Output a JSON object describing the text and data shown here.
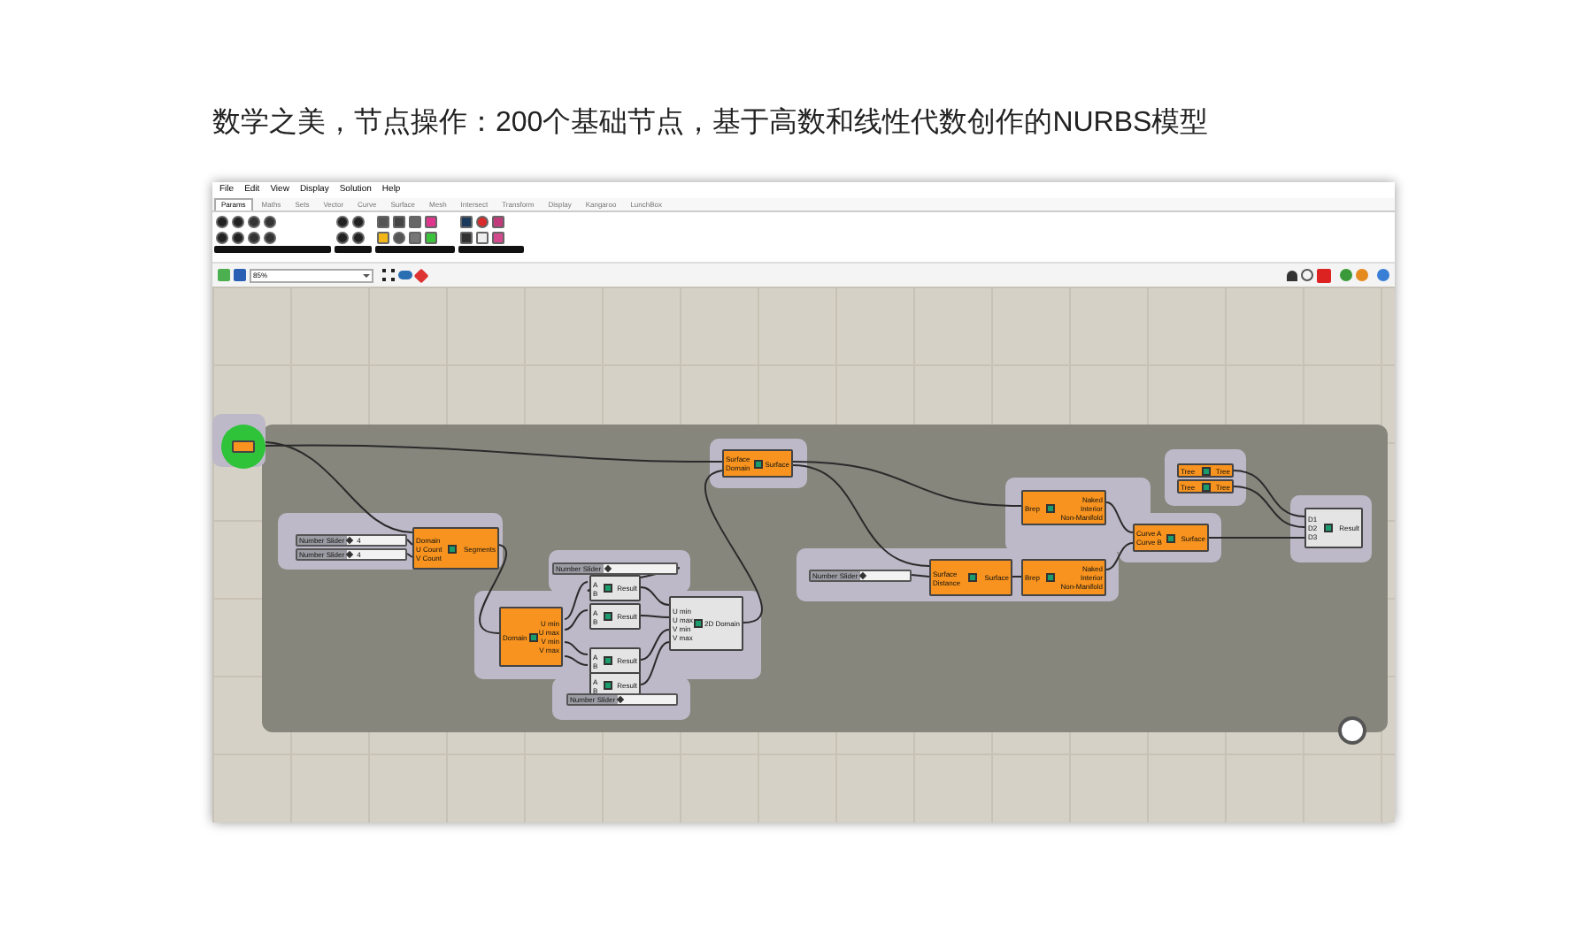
{
  "heading": "数学之美，节点操作：200个基础节点，基于高数和线性代数创作的NURBS模型",
  "menu": [
    "File",
    "Edit",
    "View",
    "Display",
    "Solution",
    "Help"
  ],
  "tabs": [
    {
      "label": "Params",
      "selected": true
    },
    {
      "label": "Maths",
      "selected": false
    },
    {
      "label": "Sets",
      "selected": false
    },
    {
      "label": "Vector",
      "selected": false
    },
    {
      "label": "Curve",
      "selected": false
    },
    {
      "label": "Surface",
      "selected": false
    },
    {
      "label": "Mesh",
      "selected": false
    },
    {
      "label": "Intersect",
      "selected": false
    },
    {
      "label": "Transform",
      "selected": false
    },
    {
      "label": "Display",
      "selected": false
    },
    {
      "label": "Kangaroo",
      "selected": false
    },
    {
      "label": "LunchBox",
      "selected": false
    }
  ],
  "canvas_toolbar": {
    "zoom": "85%"
  },
  "nodes": [
    {
      "kind": "cluster",
      "selected": true
    },
    {
      "kind": "slider",
      "label": "Number Slider",
      "value": "4",
      "level": 0.05
    },
    {
      "kind": "slider",
      "label": "Number Slider",
      "value": "4",
      "level": 0.05
    },
    {
      "kind": "component",
      "selected": true,
      "inputs": [
        "Domain",
        "U Count",
        "V Count"
      ],
      "outputs": [
        "Segments"
      ]
    },
    {
      "kind": "component",
      "selected": true,
      "inputs": [
        "Domain"
      ],
      "outputs": [
        "U min",
        "U max",
        "V min",
        "V max"
      ]
    },
    {
      "kind": "slider",
      "label": "Number Slider",
      "level": 0.05
    },
    {
      "kind": "component",
      "selected": false,
      "inputs": [
        "A",
        "B"
      ],
      "outputs": [
        "Result"
      ]
    },
    {
      "kind": "component",
      "selected": false,
      "inputs": [
        "A",
        "B"
      ],
      "outputs": [
        "Result"
      ]
    },
    {
      "kind": "component",
      "selected": false,
      "inputs": [
        "A",
        "B"
      ],
      "outputs": [
        "Result"
      ]
    },
    {
      "kind": "component",
      "selected": false,
      "inputs": [
        "A",
        "B"
      ],
      "outputs": [
        "Result"
      ]
    },
    {
      "kind": "component",
      "selected": false,
      "inputs": [
        "U min",
        "U max",
        "V min",
        "V max"
      ],
      "outputs": [
        "2D Domain"
      ]
    },
    {
      "kind": "slider",
      "label": "Number Slider",
      "level": 0.05
    },
    {
      "kind": "component",
      "selected": true,
      "inputs": [
        "Surface",
        "Domain"
      ],
      "outputs": [
        "Surface"
      ]
    },
    {
      "kind": "slider",
      "label": "Number Slider",
      "level": 0.05
    },
    {
      "kind": "component",
      "selected": true,
      "inputs": [
        "Surface",
        "Distance"
      ],
      "outputs": [
        "Surface"
      ]
    },
    {
      "kind": "component",
      "selected": true,
      "inputs": [
        "Brep"
      ],
      "outputs": [
        "Naked",
        "Interior",
        "Non-Manifold"
      ]
    },
    {
      "kind": "component",
      "selected": true,
      "inputs": [
        "Brep"
      ],
      "outputs": [
        "Naked",
        "Interior",
        "Non-Manifold"
      ]
    },
    {
      "kind": "component",
      "selected": true,
      "inputs": [
        "Curve A",
        "Curve B"
      ],
      "outputs": [
        "Surface"
      ]
    },
    {
      "kind": "component",
      "selected": true,
      "inputs": [
        "Tree"
      ],
      "outputs": [
        "Tree"
      ]
    },
    {
      "kind": "component",
      "selected": true,
      "inputs": [
        "Tree"
      ],
      "outputs": [
        "Tree"
      ]
    },
    {
      "kind": "component",
      "selected": false,
      "inputs": [
        "D1",
        "D2",
        "D3"
      ],
      "outputs": [
        "Result"
      ]
    },
    {
      "kind": "cluster",
      "selected": false
    }
  ]
}
